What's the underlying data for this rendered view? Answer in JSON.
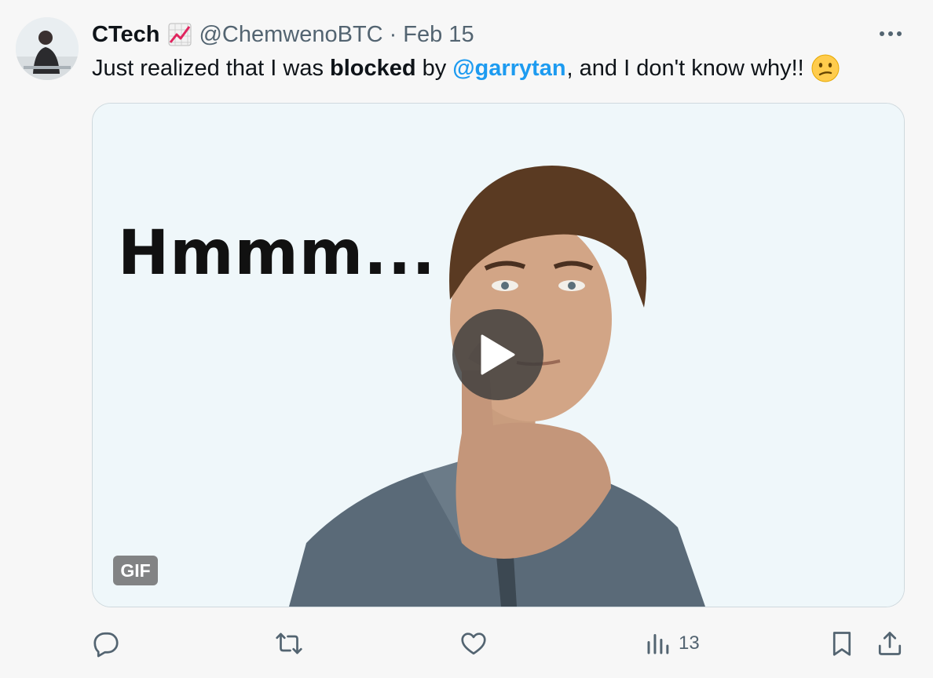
{
  "tweet": {
    "author": {
      "display_name": "CTech",
      "handle": "@ChemwenoBTC",
      "badge_icon": "chart-increasing-icon"
    },
    "separator": "·",
    "date": "Feb 15",
    "text": {
      "part1": "Just realized that I was",
      "bold": "blocked",
      "part2": "by",
      "mention": "@garrytan",
      "part3": ", and I don't know why!!",
      "emoji_icon": "confused-face-icon"
    },
    "media": {
      "caption": "Hmmm...",
      "badge": "GIF",
      "play_icon": "play-icon"
    },
    "actions": {
      "views": "13"
    }
  },
  "colors": {
    "accent": "#1d9bf0",
    "muted": "#536471",
    "text": "#0f1419",
    "background": "#f7f7f7"
  }
}
